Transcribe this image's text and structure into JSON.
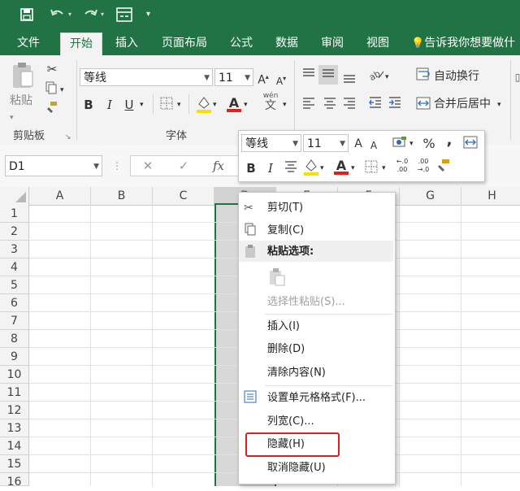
{
  "quick_access": {
    "save_icon": "save-icon",
    "undo_icon": "undo-icon",
    "redo_icon": "redo-icon",
    "view_icon": "view-icon",
    "customize_icon": "customize-icon"
  },
  "tabs": {
    "file": "文件",
    "home": "开始",
    "insert": "插入",
    "page_layout": "页面布局",
    "formulas": "公式",
    "data": "数据",
    "review": "审阅",
    "view": "视图",
    "tell_me": "告诉我你想要做什"
  },
  "clipboard": {
    "paste_label": "粘贴",
    "group_label": "剪贴板"
  },
  "font": {
    "font_name": "等线",
    "font_size": "11",
    "bold": "B",
    "italic": "I",
    "underline": "U",
    "font_color_letter": "A",
    "phonetic": "wén",
    "group_label": "字体",
    "grow": "A",
    "shrink": "A"
  },
  "alignment": {
    "wrap_text": "自动换行",
    "merge_center": "合并后居中"
  },
  "formula_bar": {
    "name_box": "D1",
    "cancel": "✕",
    "enter": "✓",
    "fx": "fx"
  },
  "columns": [
    "A",
    "B",
    "C",
    "D",
    "E",
    "F",
    "G",
    "H"
  ],
  "rows": [
    "1",
    "2",
    "3",
    "4",
    "5",
    "6",
    "7",
    "8",
    "9",
    "10",
    "11",
    "12",
    "13",
    "14",
    "15",
    "16"
  ],
  "mini_toolbar": {
    "font_name": "等线",
    "font_size": "11",
    "grow": "A",
    "shrink": "A",
    "percent": "%",
    "comma": ",",
    "bold": "B",
    "italic": "I",
    "font_color_letter": "A",
    "increase_decimal": "←.0\n.00",
    "decrease_decimal": ".00\n→.0"
  },
  "context_menu": {
    "cut": "剪切(T)",
    "copy": "复制(C)",
    "paste_options": "粘贴选项:",
    "paste_special": "选择性粘贴(S)...",
    "insert": "插入(I)",
    "delete": "删除(D)",
    "clear_contents": "清除内容(N)",
    "format_cells": "设置单元格格式(F)...",
    "column_width": "列宽(C)...",
    "hide": "隐藏(H)",
    "unhide": "取消隐藏(U)"
  },
  "colors": {
    "excel_green": "#217346",
    "highlight_red": "#e02020",
    "selected_col": "#d8d8d8",
    "font_red": "#e0201c",
    "fill_yellow": "#f5e000"
  }
}
